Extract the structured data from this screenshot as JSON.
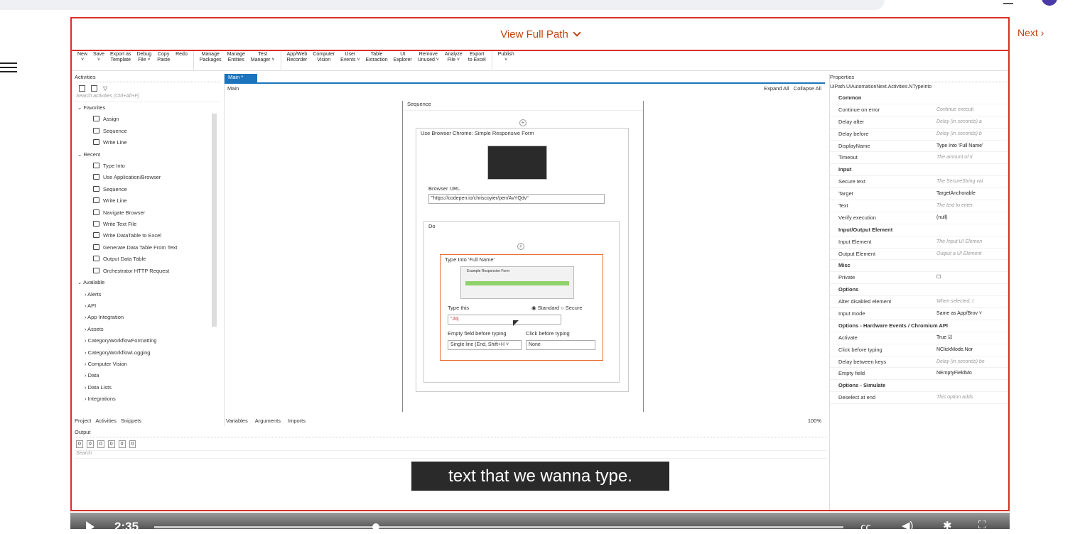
{
  "browser": {
    "url_text": ""
  },
  "header": {
    "view_full_path": "View Full Path",
    "next": "Next ›"
  },
  "ribbon": [
    {
      "label": "New\n˅"
    },
    {
      "label": "Save\n˅"
    },
    {
      "label": "Export as\nTemplate"
    },
    {
      "label": "Debug\nFile ˅"
    },
    {
      "label": "Copy\nPaste"
    },
    {
      "label": "Redo"
    },
    {
      "label": "Manage\nPackages"
    },
    {
      "label": "Manage\nEntities"
    },
    {
      "label": "Test\nManager ˅"
    },
    {
      "label": "App/Web\nRecorder"
    },
    {
      "label": "Computer\nVision"
    },
    {
      "label": "User\nEvents ˅"
    },
    {
      "label": "Table\nExtraction"
    },
    {
      "label": "UI\nExplorer"
    },
    {
      "label": "Remove\nUnused ˅"
    },
    {
      "label": "Analyze\nFile ˅"
    },
    {
      "label": "Export\nto Excel"
    },
    {
      "label": "Publish\n˅"
    }
  ],
  "activities": {
    "title": "Activities",
    "search_placeholder": "Search activities (Ctrl+Alt+F)",
    "favorites_label": "Favorites",
    "favorites": [
      "Assign",
      "Sequence",
      "Write Line"
    ],
    "recent_label": "Recent",
    "recent": [
      "Type Into",
      "Use Application/Browser",
      "Sequence",
      "Write Line",
      "Navigate Browser",
      "Write Text File",
      "Write DataTable to Excel",
      "Generate Data Table From Text",
      "Output Data Table",
      "Orchestrator HTTP Request"
    ],
    "available_label": "Available",
    "available": [
      "Alerts",
      "API",
      "App Integration",
      "Assets",
      "CategoryWorkflowFormatting",
      "CategoryWorkflowLogging",
      "Computer Vision",
      "Data",
      "Data Lists",
      "Integrations"
    ],
    "bottom_tabs": [
      "Project",
      "Activities",
      "Snippets"
    ]
  },
  "designer": {
    "tab": "Main *",
    "breadcrumb": "Main",
    "expand_all": "Expand All",
    "collapse_all": "Collapse All",
    "sequence": "Sequence",
    "browser_card": "Use Browser Chrome: Simple Responsive Form",
    "browser_url_label": "Browser URL",
    "browser_url": "\"https://codepen.io/chriscoyier/pen/AvYQdv\"",
    "do_label": "Do",
    "type_into_title": "Type Into 'Full Name'",
    "thumb_title": "Example Responsive Form",
    "type_this_label": "Type this",
    "standard": "Standard",
    "secure": "Secure",
    "type_value": "\"Jo|",
    "empty_field_label": "Empty field before typing",
    "empty_field_value": "Single line (End, Shift+H ˅",
    "click_before_label": "Click before typing",
    "click_before_value": "None",
    "bottom_tabs": [
      "Variables",
      "Arguments",
      "Imports"
    ],
    "zoom": "100%"
  },
  "properties": {
    "title": "Properties",
    "type": "UiPath.UIAutomationNext.Activities.NTypeInto",
    "rows": [
      {
        "k": "Common",
        "v": "",
        "cat": true
      },
      {
        "k": "Continue on error",
        "v": "Continue executi"
      },
      {
        "k": "Delay after",
        "v": "Delay (in seconds) a"
      },
      {
        "k": "Delay before",
        "v": "Delay (in seconds) b"
      },
      {
        "k": "DisplayName",
        "v": "Type Into 'Full Name'",
        "n": true
      },
      {
        "k": "Timeout",
        "v": "The amount of ti"
      },
      {
        "k": "Input",
        "v": "",
        "cat": true
      },
      {
        "k": "Secure text",
        "v": "The SecureString val."
      },
      {
        "k": "Target",
        "v": "TargetAnchorable",
        "n": true
      },
      {
        "k": "Text",
        "v": "The text to enter."
      },
      {
        "k": "Verify execution",
        "v": "(null)",
        "n": true
      },
      {
        "k": "Input/Output Element",
        "v": "",
        "cat": true
      },
      {
        "k": "Input Element",
        "v": "The Input UI Elemen"
      },
      {
        "k": "Output Element",
        "v": "Output a UI Element"
      },
      {
        "k": "Misc",
        "v": "",
        "cat": true
      },
      {
        "k": "Private",
        "v": "☐",
        "n": true
      },
      {
        "k": "Options",
        "v": "",
        "cat": true
      },
      {
        "k": "Alter disabled element",
        "v": "When selected, t"
      },
      {
        "k": "Input mode",
        "v": "Same as App/Brov ˅",
        "n": true
      },
      {
        "k": "Options - Hardware Events / Chromium API",
        "v": "",
        "cat": true
      },
      {
        "k": "Activate",
        "v": "True  ☑",
        "n": true
      },
      {
        "k": "Click before typing",
        "v": "NClickMode.Nor",
        "n": true
      },
      {
        "k": "Delay between keys",
        "v": "Delay (in seconds) be"
      },
      {
        "k": "Empty field",
        "v": "NEmptyFieldMo",
        "n": true
      },
      {
        "k": "Options - Simulate",
        "v": "",
        "cat": true
      },
      {
        "k": "Deselect at end",
        "v": "This option adds"
      }
    ]
  },
  "output": {
    "title": "Output",
    "badges": [
      "0",
      "0",
      "0",
      "0",
      "0",
      "0"
    ],
    "search_placeholder": "Search"
  },
  "video": {
    "caption": "text that we wanna type.",
    "time": "2:35"
  }
}
